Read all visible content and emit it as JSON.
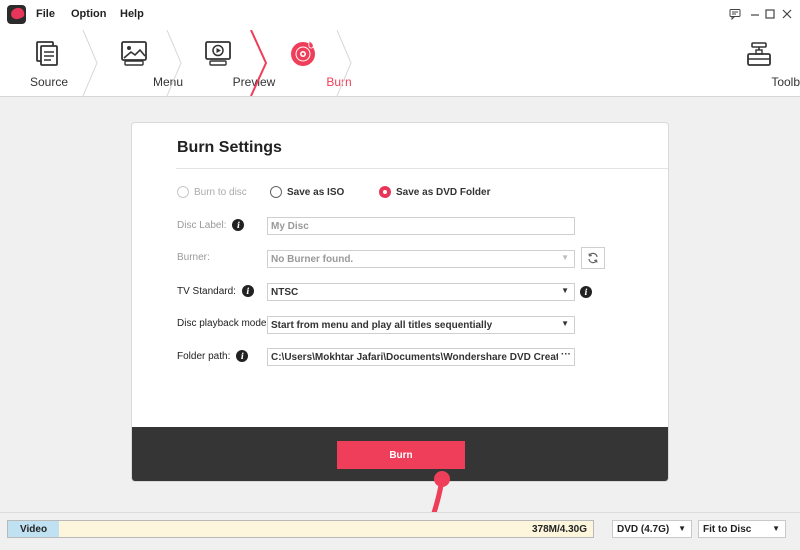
{
  "menu": {
    "file": "File",
    "option": "Option",
    "help": "Help"
  },
  "steps": [
    {
      "label": "Source",
      "icon": "source-icon",
      "active": false
    },
    {
      "label": "Menu",
      "icon": "menu-image-icon",
      "active": false
    },
    {
      "label": "Preview",
      "icon": "preview-play-icon",
      "active": false
    },
    {
      "label": "Burn",
      "icon": "burn-disc-icon",
      "active": true
    }
  ],
  "toolbox": {
    "label": "Toolbox",
    "icon": "toolbox-icon"
  },
  "panel": {
    "title": "Burn Settings",
    "modes": [
      {
        "label": "Burn to disc",
        "state": "disabled"
      },
      {
        "label": "Save as ISO",
        "state": "unchecked"
      },
      {
        "label": "Save as DVD Folder",
        "state": "checked"
      }
    ],
    "disc_label": {
      "label": "Disc Label:",
      "value": "My Disc"
    },
    "burner": {
      "label": "Burner:",
      "value": "No Burner found."
    },
    "tv_standard": {
      "label": "TV Standard:",
      "value": "NTSC"
    },
    "playback": {
      "label": "Disc playback mode:",
      "value": "Start from menu and play all titles sequentially"
    },
    "folder": {
      "label": "Folder path:",
      "value": "C:\\Users\\Mokhtar Jafari\\Documents\\Wondershare DVD Creator\\O",
      "browse": "···"
    },
    "burn_button": "Burn"
  },
  "status": {
    "type_label": "Video",
    "size": "378M/4.30G",
    "used_fraction": 0.088,
    "disc_type": "DVD (4.7G)",
    "fit": "Fit to Disc"
  },
  "colors": {
    "accent": "#ef3e5a",
    "strip": "#353535"
  }
}
